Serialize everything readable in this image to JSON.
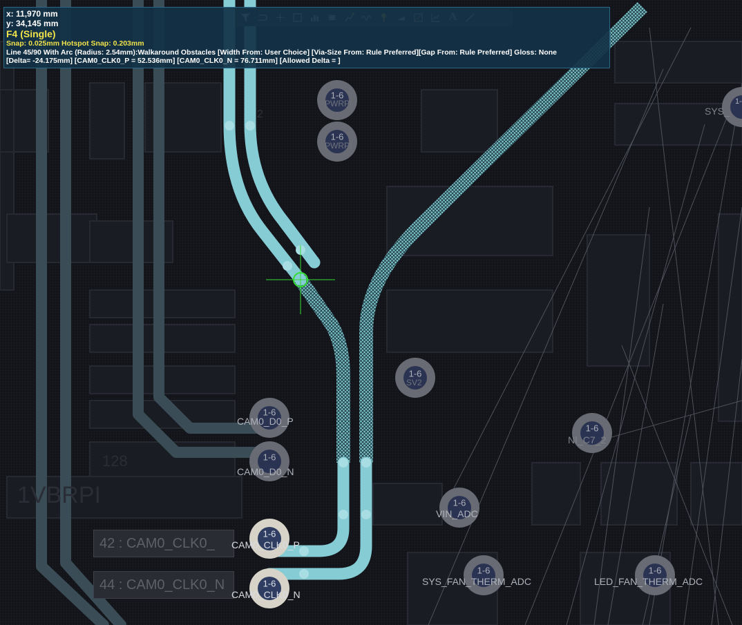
{
  "hud": {
    "x": "x: 11,970  mm",
    "y": "y: 34,145  mm",
    "mode": "F4 (Single)",
    "snap": "Snap: 0.025mm Hotspot Snap: 0.203mm",
    "line_info": "Line 45/90 With Arc (Radius: 2.54mm):Walkaround Obstacles [Width From: User Choice]  [Via-Size From: Rule Preferred][Gap From: Rule Preferred] Gloss: None",
    "delta_info": "[Delta= -24.175mm] [CAM0_CLK0_P = 52.536mm] [CAM0_CLK0_N = 76.711mm] [Allowed Delta = ]"
  },
  "toolbar": {
    "icons": [
      "filter-icon",
      "route-icon",
      "add-icon",
      "rectangle-icon",
      "bar-chart-icon",
      "component-icon",
      "interactive-route-icon",
      "signal-icon",
      "key-icon",
      "layer-stack-icon",
      "dimension-icon",
      "chart-icon",
      "text-icon",
      "line-icon"
    ]
  },
  "board": {
    "pads": [
      {
        "layer": "1-6",
        "net": "CAM0_D0_P"
      },
      {
        "layer": "1-6",
        "net": "CAM0_D0_N"
      },
      {
        "layer": "1-6",
        "net": "CAM0_CLK0_P"
      },
      {
        "layer": "1-6",
        "net": "CAM0_CLK0_N"
      },
      {
        "layer": "1-6",
        "net": "VIN_ADC"
      },
      {
        "layer": "1-6",
        "net": "SYS_FAN_THERM_ADC"
      },
      {
        "layer": "1-6",
        "net": "LED_FAN_THERM_ADC"
      },
      {
        "layer": "1-6",
        "net": "NI_C7_2"
      },
      {
        "layer": "1-6",
        "net": "SV2"
      },
      {
        "layer": "1-6",
        "net": "PWRPI"
      },
      {
        "layer": "1-6",
        "net": "PWRPI"
      },
      {
        "layer": "1-6",
        "net": "SYS"
      }
    ],
    "connector_labels": [
      "42 : CAM0_CLK0_",
      "44 : CAM0_CLK0_N"
    ],
    "faint_labels": [
      "1VBRPI",
      "SYS_",
      "2",
      "128"
    ]
  },
  "colors": {
    "trace": "#86ccd4",
    "hud_bg": "#143246",
    "hud_text": "#ffffff",
    "hud_highlight": "#f0e24a",
    "cursor": "#33dd33"
  }
}
